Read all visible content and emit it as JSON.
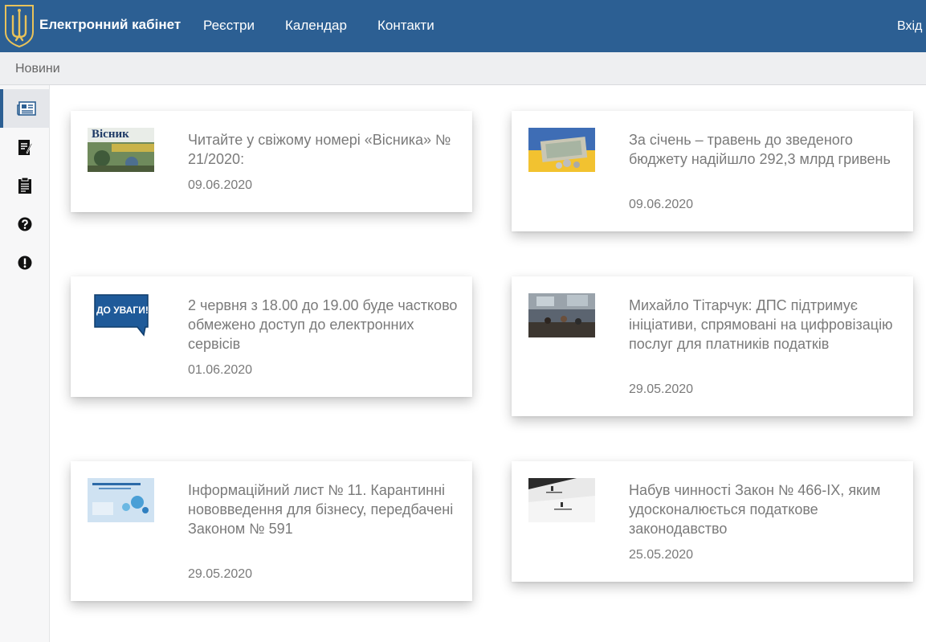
{
  "header": {
    "brand": "Електронний кабінет",
    "nav": [
      "Реєстри",
      "Календар",
      "Контакти"
    ],
    "login_label": "Вхід",
    "brand_color": "#2c5f93"
  },
  "subheader": {
    "title": "Новини"
  },
  "sidebar": {
    "items": [
      {
        "icon": "newspaper-icon",
        "active": true
      },
      {
        "icon": "document-edit-icon",
        "active": false
      },
      {
        "icon": "clipboard-icon",
        "active": false
      },
      {
        "icon": "question-circle-icon",
        "active": false
      },
      {
        "icon": "exclamation-circle-icon",
        "active": false
      }
    ]
  },
  "news": [
    {
      "title": "Читайте у свіжому номері «Вісника» № 21/2020:",
      "date": "09.06.2020",
      "thumb": "visnyk-thumb",
      "thumb_text": "Вісник"
    },
    {
      "title": "За січень – травень до зведеного бюджету надійшло 292,3 млрд гривень",
      "date": "09.06.2020",
      "thumb": "money-thumb"
    },
    {
      "title": "2 червня з 18.00 до 19.00 буде частково обмежено доступ до електронних сервісів",
      "date": "01.06.2020",
      "thumb": "attention-thumb",
      "thumb_text": "ДО УВАГИ!"
    },
    {
      "title": "Михайло Тітарчук: ДПС підтримує ініціативи, спрямовані на цифровізацію послуг для платників податків",
      "date": "29.05.2020",
      "thumb": "office-photo-thumb"
    },
    {
      "title": "Інформаційний лист № 11. Карантинні нововведення для бізнесу, передбачені Законом № 591",
      "date": "29.05.2020",
      "thumb": "info-letter-thumb"
    },
    {
      "title": "Набув чинності Закон № 466-IX, яким удосконалюється податкове законодавство",
      "date": "25.05.2020",
      "thumb": "law-book-thumb"
    }
  ]
}
